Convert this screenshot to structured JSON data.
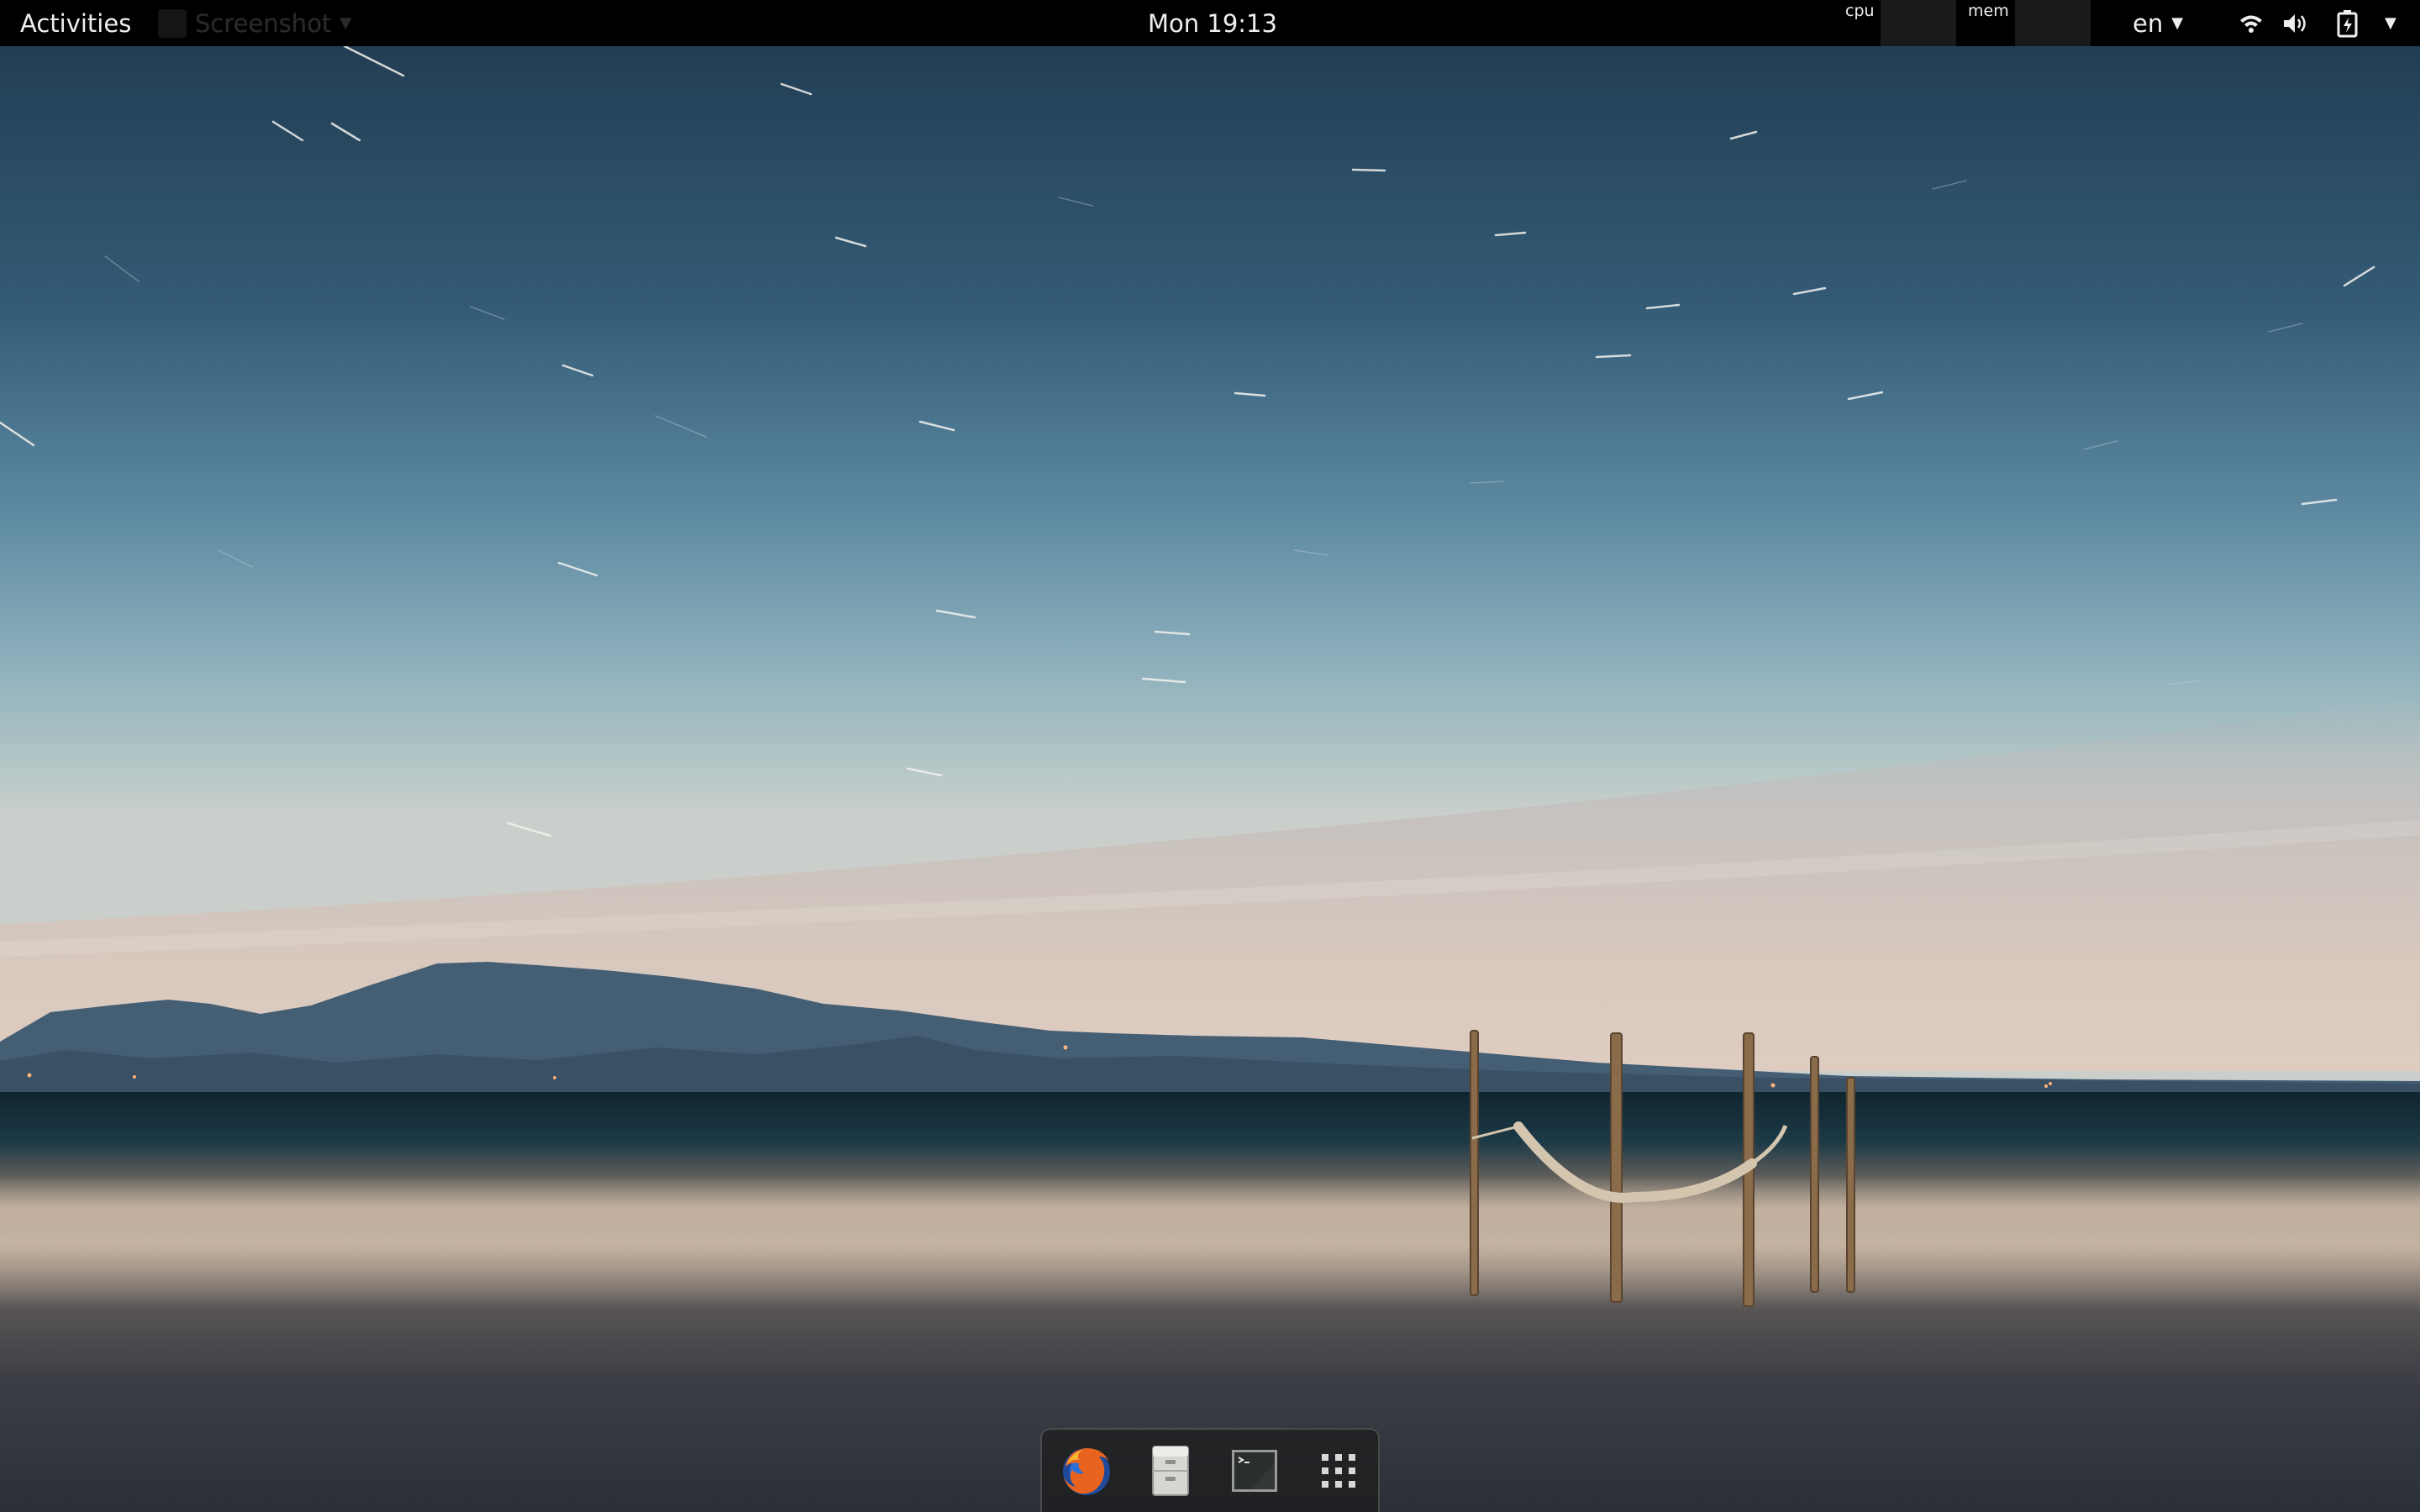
{
  "topbar": {
    "activities_label": "Activities",
    "app_menu": {
      "label": "Screenshot"
    },
    "clock": "Mon 19:13",
    "system_monitor": {
      "cpu_label": "cpu",
      "mem_label": "mem"
    },
    "keyboard_layout": "en",
    "icons": [
      "wifi-icon",
      "volume-icon",
      "battery-icon",
      "system-menu-caret-icon"
    ]
  },
  "dash": {
    "items": [
      {
        "icon": "firefox-icon"
      },
      {
        "icon": "files-icon"
      },
      {
        "icon": "terminal-icon"
      },
      {
        "icon": "show-applications-icon"
      }
    ]
  },
  "colors": {
    "topbar_bg": "#000000",
    "topbar_text": "#eeeeec",
    "sky_top": "#2b4a60",
    "sky_horizon": "#b6c9c9",
    "sea": "#152a33"
  }
}
